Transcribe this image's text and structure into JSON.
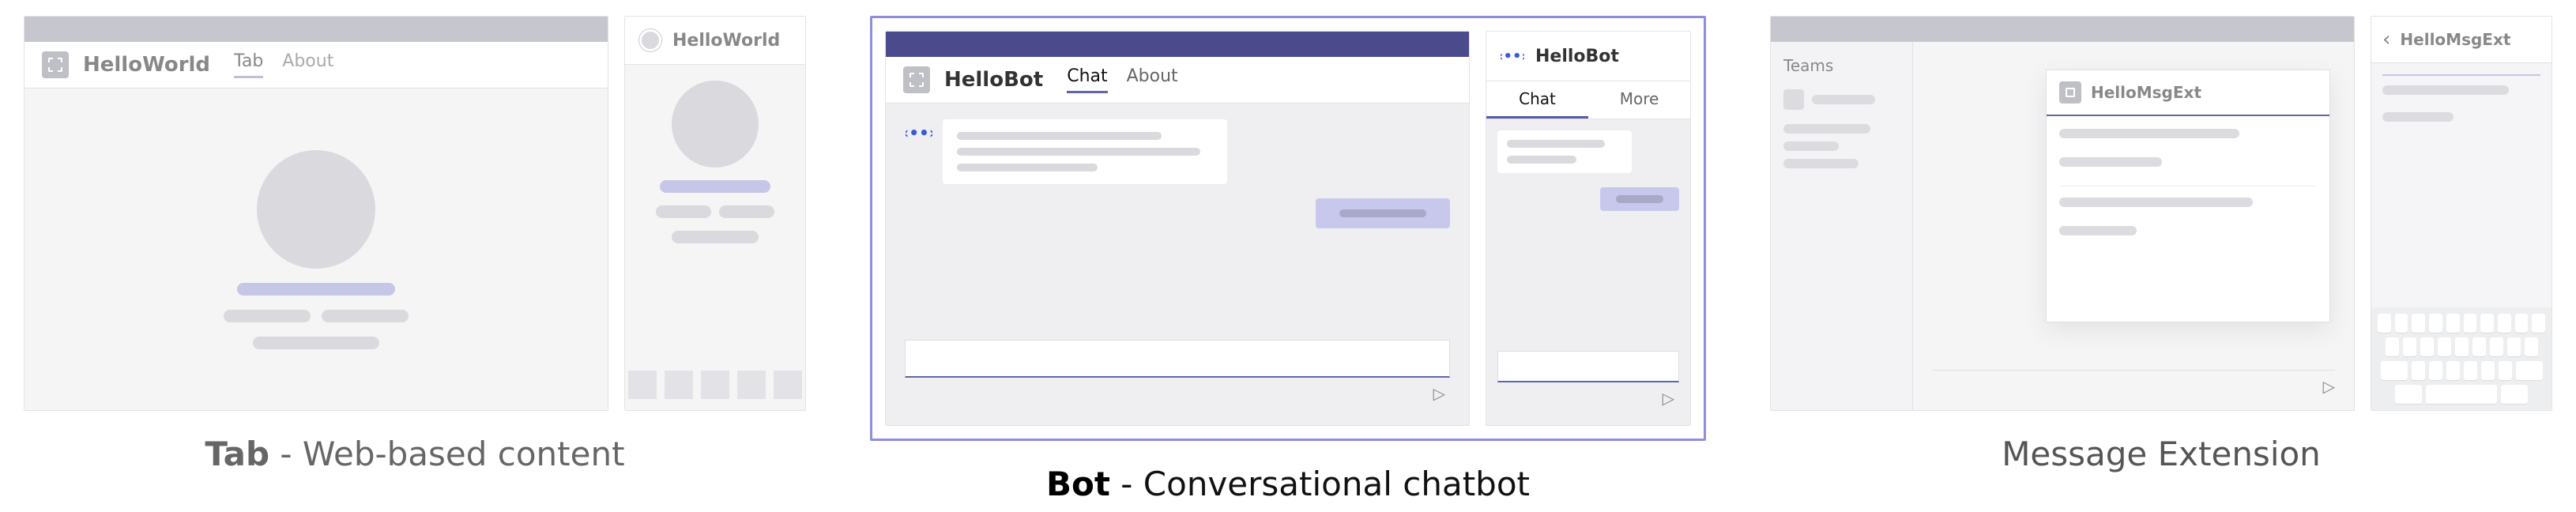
{
  "groups": {
    "tab": {
      "caption_strong": "Tab",
      "caption_rest": " - Web-based content",
      "desktop": {
        "app_title": "HelloWorld",
        "tabs": [
          "Tab",
          "About"
        ],
        "active_tab_index": 0
      },
      "mobile": {
        "app_title": "HelloWorld"
      }
    },
    "bot": {
      "caption_strong": "Bot",
      "caption_rest": " - Conversational chatbot",
      "desktop": {
        "app_title": "HelloBot",
        "tabs": [
          "Chat",
          "About"
        ],
        "active_tab_index": 0
      },
      "mobile": {
        "app_title": "HelloBot",
        "tabs": [
          "Chat",
          "More"
        ],
        "active_tab_index": 0
      }
    },
    "me": {
      "caption": "Message Extension",
      "desktop": {
        "sidebar_label": "Teams",
        "popup_title": "HelloMsgExt"
      },
      "mobile": {
        "title": "HelloMsgExt"
      }
    }
  },
  "icons": {
    "bot_glyph": "‹∙∙›",
    "send": "▷",
    "back": "‹"
  },
  "colors": {
    "accent": "#6264a7",
    "selection_border": "#8d8de0",
    "titlebar_purple": "#4a4a8c"
  }
}
